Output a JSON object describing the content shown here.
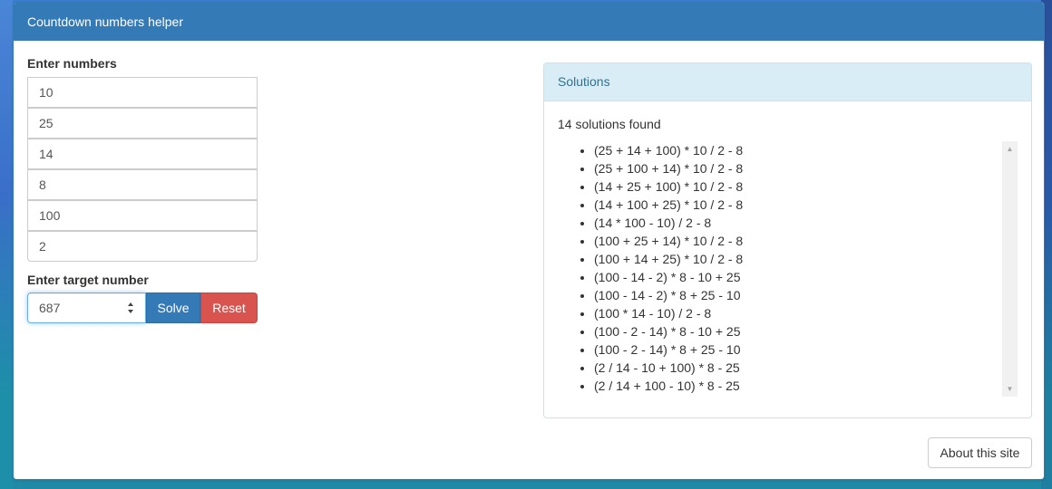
{
  "header": {
    "title": "Countdown numbers helper"
  },
  "form": {
    "numbers_label": "Enter numbers",
    "numbers": [
      "10",
      "25",
      "14",
      "8",
      "100",
      "2"
    ],
    "target_label": "Enter target number",
    "target_value": "687",
    "solve_label": "Solve",
    "reset_label": "Reset"
  },
  "solutions": {
    "heading": "Solutions",
    "count_text": "14 solutions found",
    "items": [
      "(25 + 14 + 100) * 10 / 2 - 8",
      "(25 + 100 + 14) * 10 / 2 - 8",
      "(14 + 25 + 100) * 10 / 2 - 8",
      "(14 + 100 + 25) * 10 / 2 - 8",
      "(14 * 100 - 10) / 2 - 8",
      "(100 + 25 + 14) * 10 / 2 - 8",
      "(100 + 14 + 25) * 10 / 2 - 8",
      "(100 - 14 - 2) * 8 - 10 + 25",
      "(100 - 14 - 2) * 8 + 25 - 10",
      "(100 * 14 - 10) / 2 - 8",
      "(100 - 2 - 14) * 8 - 10 + 25",
      "(100 - 2 - 14) * 8 + 25 - 10",
      "(2 / 14 - 10 + 100) * 8 - 25",
      "(2 / 14 + 100 - 10) * 8 - 25"
    ]
  },
  "footer": {
    "about_label": "About this site"
  },
  "colors": {
    "primary": "#337ab7",
    "danger": "#d9534f",
    "info_bg": "#d9edf7",
    "info_text": "#31708f"
  }
}
